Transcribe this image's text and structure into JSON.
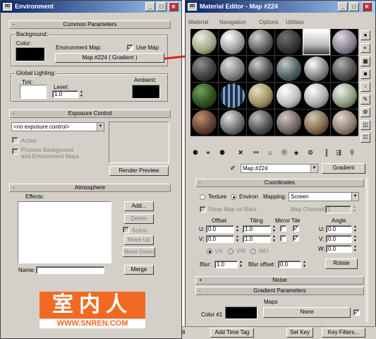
{
  "env": {
    "title": "Environment",
    "common_params": "Common Parameters",
    "background": "Background:",
    "color": "Color:",
    "env_map": "Environment Map:",
    "use_map": "Use Map",
    "map_button": "Map #224  ( Gradient )",
    "global_lighting": "Global Lighting:",
    "tint": "Tint:",
    "level": "Level:",
    "level_value": "1.0",
    "ambient": "Ambient:",
    "exposure": "Exposure Control",
    "exposure_select": "<no exposure control>",
    "active": "Active",
    "process_bg": "Process Background",
    "and_env": "and Environment Maps",
    "render_preview": "Render Preview",
    "atmosphere": "Atmosphere",
    "effects": "Effects:",
    "add": "Add...",
    "delete": "Delete",
    "active2": "Active",
    "move_up": "Move Up",
    "move_down": "Move Down",
    "name": "Name:",
    "merge": "Merge"
  },
  "logo": {
    "text": "室内人",
    "url": "WWW.SNREN.COM"
  },
  "mat": {
    "title": "Material Editor - Map #224",
    "menu": [
      "Material",
      "Navigation",
      "Options",
      "Utilities"
    ],
    "map_name": "Map #224",
    "type_btn": "Gradient",
    "coordinates": "Coordinates",
    "texture": "Texture",
    "environ": "Environ",
    "mapping": "Mapping:",
    "mapping_value": "Screen",
    "show_map": "Show Map on Back",
    "map_channel": "Map Channel:",
    "map_channel_value": "1",
    "offset": "Offset",
    "tiling": "Tiling",
    "mirror_tile": "Mirror Tile",
    "angle": "Angle",
    "u": "U:",
    "v": "V:",
    "w": "W:",
    "u_offset": "0.0",
    "v_offset": "0.0",
    "u_tiling": "1.0",
    "v_tiling": "1.0",
    "u_angle": "0.0",
    "v_angle": "0.0",
    "w_angle": "0.0",
    "uv": "UV",
    "vw": "VW",
    "wu": "WU",
    "blur": "Blur:",
    "blur_value": "1.0",
    "blur_offset": "Blur offset:",
    "blur_offset_value": "0.0",
    "rotate": "Rotate",
    "noise": "Noise",
    "gradient_params": "Gradient Parameters",
    "maps": "Maps",
    "color1": "Color #1",
    "none": "None"
  },
  "statusbar": {
    "six": "6",
    "add_time_tag": "Add Time Tag",
    "set_key": "Set Key",
    "key_filters": "Key Filters..."
  },
  "colors": {
    "arrow": "#e02020",
    "title_start": "#0a246a",
    "title_end": "#a6caf0",
    "logo": "#f26a21"
  }
}
